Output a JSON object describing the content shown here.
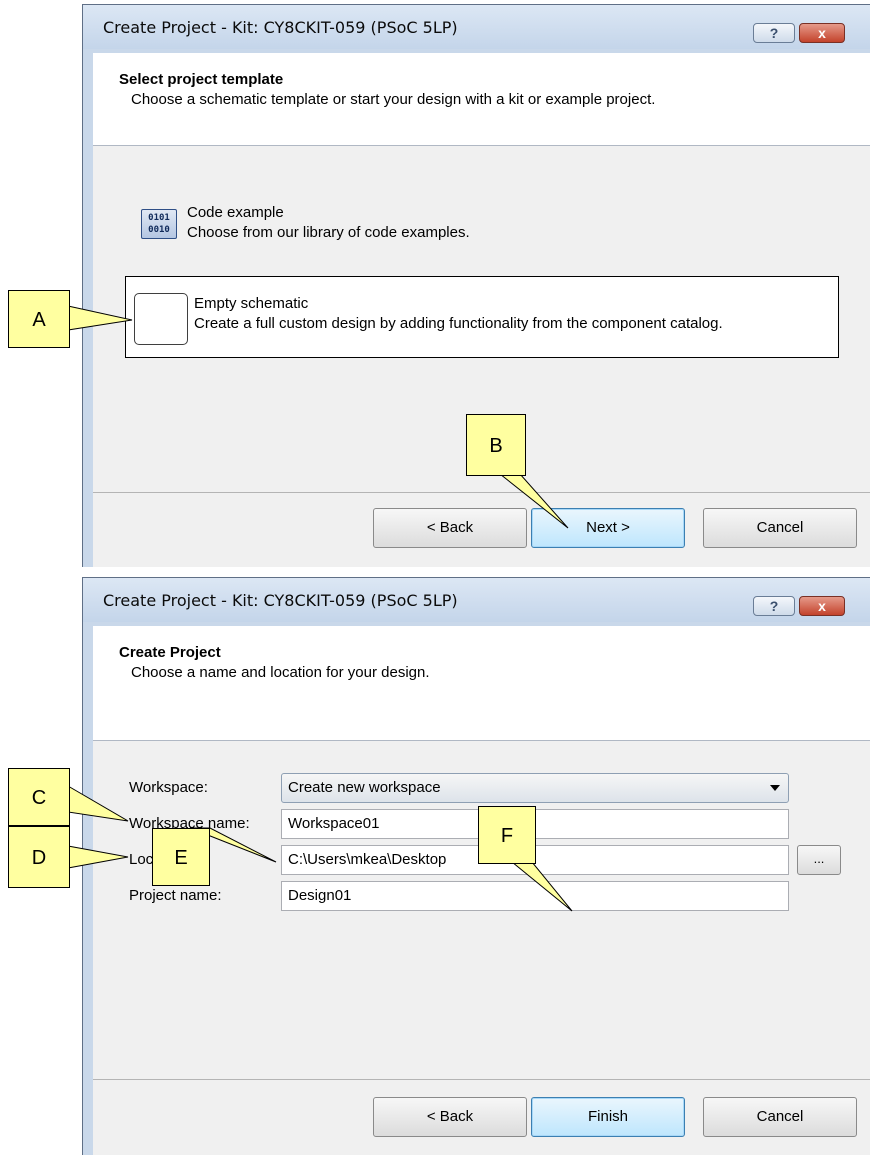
{
  "dialog1": {
    "title": "Create Project - Kit: CY8CKIT-059 (PSoC 5LP)",
    "help_label": "?",
    "close_label": "x",
    "header_title": "Select project template",
    "header_subtitle": "Choose a schematic template or start your design with a kit or example project.",
    "options": [
      {
        "title": "Code example",
        "subtitle": "Choose from our library of code examples.",
        "icon_text_1": "0101",
        "icon_text_2": "0010"
      },
      {
        "title": "Empty schematic",
        "subtitle": "Create a full custom design by adding functionality from the component catalog."
      }
    ],
    "buttons": {
      "back": "< Back",
      "next": "Next >",
      "cancel": "Cancel"
    }
  },
  "dialog2": {
    "title": "Create Project - Kit: CY8CKIT-059 (PSoC 5LP)",
    "help_label": "?",
    "close_label": "x",
    "header_title": "Create Project",
    "header_subtitle": "Choose a name and location for your design.",
    "fields": {
      "workspace_label": "Workspace:",
      "workspace_value": "Create new workspace",
      "workspace_name_label": "Workspace name:",
      "workspace_name_value": "Workspace01",
      "location_label": "Location:",
      "location_value": "C:\\Users\\mkea\\Desktop",
      "browse_label": "...",
      "project_name_label": "Project name:",
      "project_name_value": "Design01"
    },
    "buttons": {
      "back": "< Back",
      "finish": "Finish",
      "cancel": "Cancel"
    }
  },
  "callouts": {
    "a": "A",
    "b": "B",
    "c": "C",
    "d": "D",
    "e": "E",
    "f": "F"
  },
  "colors": {
    "callout_fill": "#ffffa0",
    "default_button": "#bee6fd",
    "title_bar": "#c4d5ea"
  }
}
